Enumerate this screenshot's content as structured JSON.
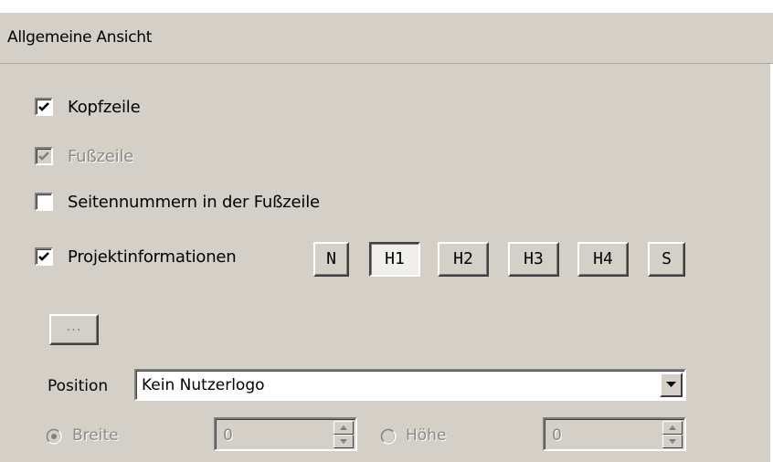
{
  "section": {
    "title": "Allgemeine Ansicht"
  },
  "options": {
    "header": {
      "label": "Kopfzeile",
      "checked": true,
      "enabled": true
    },
    "footer": {
      "label": "Fußzeile",
      "checked": true,
      "enabled": false
    },
    "page_numbers": {
      "label": "Seitennummern in der Fußzeile",
      "checked": false,
      "enabled": true
    },
    "project_info": {
      "label": "Projektinformationen",
      "checked": true,
      "enabled": true
    }
  },
  "project_info_buttons": [
    {
      "label": "N",
      "active": false
    },
    {
      "label": "H1",
      "active": true
    },
    {
      "label": "H2",
      "active": false
    },
    {
      "label": "H3",
      "active": false
    },
    {
      "label": "H4",
      "active": false
    },
    {
      "label": "S",
      "active": false
    }
  ],
  "logo": {
    "browse_label": "...",
    "position_label": "Position",
    "position_value": "Kein Nutzerlogo"
  },
  "size": {
    "width_label": "Breite",
    "width_value": "0",
    "width_selected": true,
    "height_label": "Höhe",
    "height_value": "0",
    "height_selected": false,
    "enabled": false
  },
  "icons": {
    "check": "check-mark-icon",
    "dropdown": "chevron-down-icon",
    "spin_up": "spin-up-icon",
    "spin_down": "spin-down-icon"
  }
}
